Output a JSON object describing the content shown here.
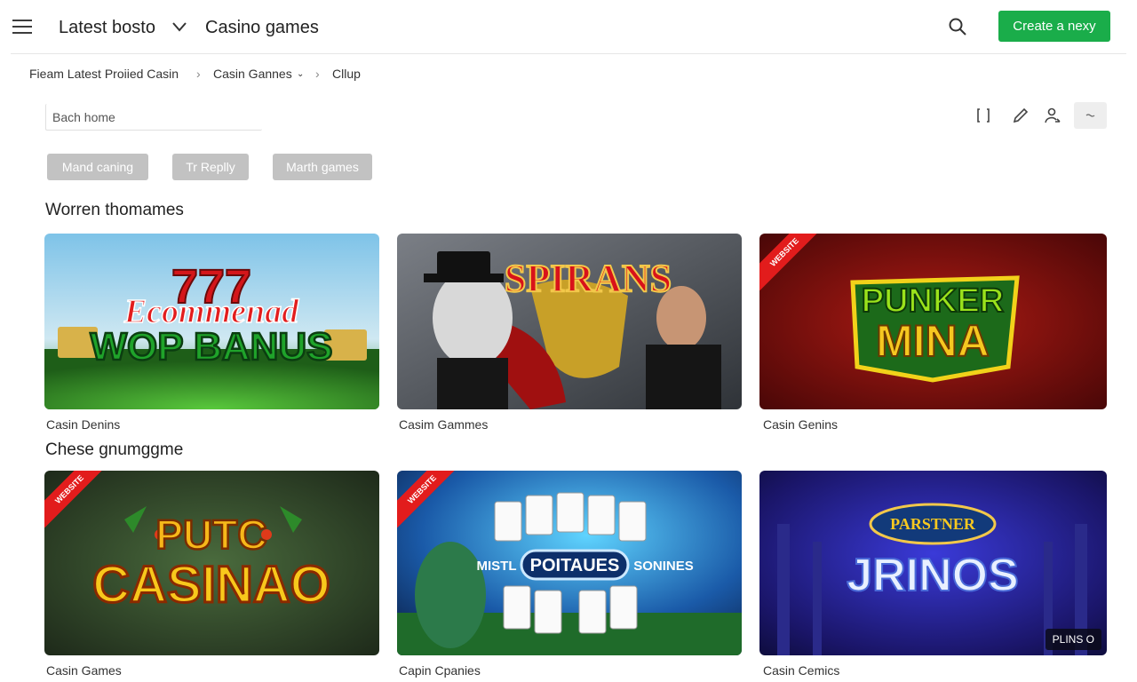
{
  "topbar": {
    "brand": "Latest bosto",
    "section": "Casino games",
    "create_button": "Create a nexy",
    "colors": {
      "create_button_bg": "#1aad4a"
    }
  },
  "breadcrumb": {
    "items": [
      "Fieam Latest Proiied Casin",
      "Casin Gannes",
      "Cllup"
    ]
  },
  "search": {
    "placeholder": "Bach home"
  },
  "chips": [
    "Mand caning",
    "Tr Replly",
    "Marth games"
  ],
  "sections": [
    {
      "heading": "Worren thomames",
      "cards": [
        {
          "art_line1": "Ecommenad",
          "art_line2": "WOP BANUS",
          "art_top": "777",
          "label": "Casin Denins"
        },
        {
          "art_title": "SPIRANS",
          "label": "Casim Gammes"
        },
        {
          "art_line1": "PUNKER",
          "art_line2": "MINA",
          "badge": "WEBSITE",
          "label": "Casin Genins"
        }
      ]
    },
    {
      "heading": "Chese gnumggme",
      "cards": [
        {
          "art_line1": "PUTC",
          "art_line2": "CASINAO",
          "badge": "WEBSITE",
          "label": "Casin Games"
        },
        {
          "art_center": "POITAUES",
          "art_left": "MISTL",
          "art_right": "SONINES",
          "badge": "WEBSITE",
          "label": "Capin Cpanies"
        },
        {
          "art_top": "PARSTNER",
          "art_title": "JRINOS",
          "tag": "PLINS O",
          "label": "Casin Cemics"
        }
      ]
    }
  ],
  "icons": [
    "menu-icon",
    "chevron-down-icon",
    "search-icon",
    "bracket-icon",
    "pencil-icon",
    "user-icon",
    "more-icon"
  ]
}
